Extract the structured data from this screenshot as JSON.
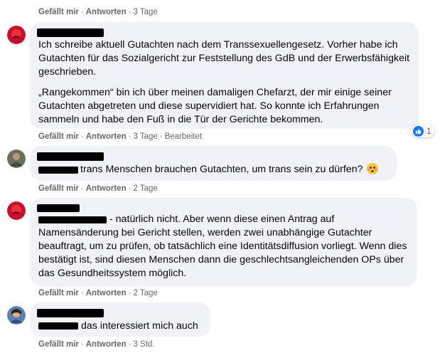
{
  "actions": {
    "like": "Gefällt mir",
    "reply": "Antworten",
    "dot": "·"
  },
  "comments": [
    {
      "time": "3 Tage"
    },
    {
      "paragraph1": "Ich schreibe aktuell Gutachten nach dem Transsexuellengesetz. Vorher habe ich Gutachten für das Sozialgericht zur Feststellung des GdB und der Erwerbsfähigkeit geschrieben.",
      "paragraph2": "„Rangekommen“ bin ich über meinen damaligen Chefarzt, der mir einige seiner Gutachten abgetreten und diese supervidiert hat. So konnte ich Erfahrungen sammeln und habe den Fuß in die Tür der Gerichte bekommen.",
      "time": "3 Tage",
      "edited": "Bearbeitet",
      "reaction_count": "1"
    },
    {
      "text": "trans Menschen brauchen Gutachten, um trans sein zu dürfen?",
      "emoji": "flushed-face-emoji",
      "time": "2 Tage"
    },
    {
      "text": "- natürlich nicht. Aber wenn diese einen Antrag auf Namensänderung bei Gericht stellen, werden zwei unabhängige Gutachter beauftragt, um zu prüfen, ob tatsächlich eine Identitätsdiffusion vorliegt. Wenn dies bestätigt ist, sind diesen Menschen dann die geschlechtsangleichenden OPs über das Gesundheitssystem möglich.",
      "time": "2 Tage"
    },
    {
      "text": "das interessiert mich auch",
      "time": "3 Std."
    }
  ],
  "colors": {
    "bubble": "#f0f2f5",
    "meta": "#65676b",
    "like": "#1877f2",
    "text": "#050505"
  }
}
